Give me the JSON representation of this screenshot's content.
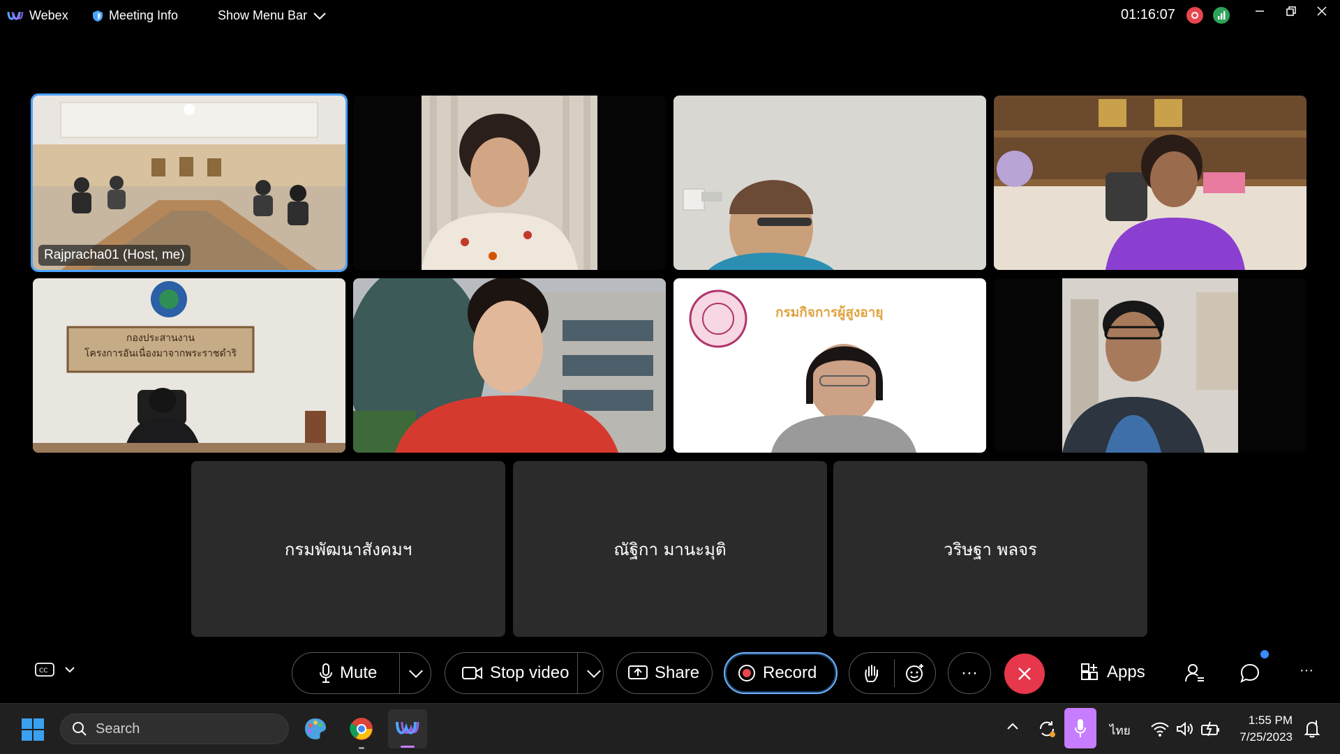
{
  "topbar": {
    "app_name": "Webex",
    "meeting_info": "Meeting Info",
    "show_menu_bar": "Show Menu Bar",
    "timer": "01:16:07"
  },
  "tiles": [
    {
      "name": "Rajpracha01 (Host, me)"
    }
  ],
  "tile_texts": {
    "sign_line1": "กองประสานงาน",
    "sign_line2": "โครงการอันเนื่องมาจากพระราชดำริ",
    "slide_title": "กรมกิจการผู้สูงอายุ"
  },
  "audio_only": [
    {
      "name": "กรมพัฒนาสังคมฯ"
    },
    {
      "name": "ณัฐิกา มานะมุติ"
    },
    {
      "name": "วริษฐา พลจร"
    }
  ],
  "controls": {
    "mute": "Mute",
    "stop_video": "Stop video",
    "share": "Share",
    "record": "Record",
    "more": "···",
    "apps": "Apps",
    "overflow": "···"
  },
  "taskbar": {
    "search_placeholder": "Search",
    "language": "ไทย",
    "time": "1:55 PM",
    "date": "7/25/2023"
  },
  "colors": {
    "accent_blue": "#4aa3ff",
    "end_call_red": "#e6374b",
    "record_red": "#e8454f",
    "signal_green": "#2ea35a"
  }
}
